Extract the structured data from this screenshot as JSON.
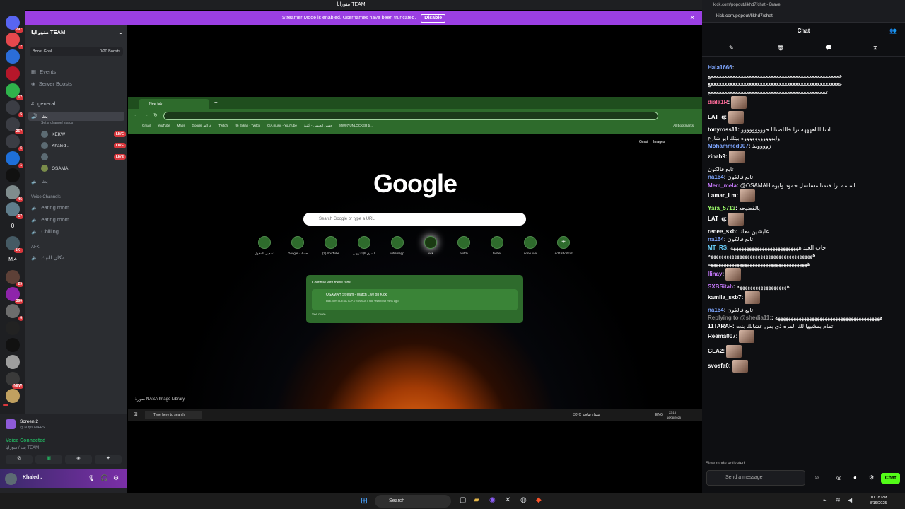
{
  "discord": {
    "window_title": "منورايا TEAM",
    "banner_text": "Streamer Mode is enabled. Usernames have been truncated.",
    "banner_button": "Disable",
    "server_name": "منورايا TEAM",
    "boost_goal": "Boost Goal",
    "boost_count": "0/20 Boosts",
    "menu": [
      "Events",
      "Server Boosts"
    ],
    "text_channel": "general",
    "voice_channel": "بث",
    "channel_status": "Set a channel status",
    "voice_users": [
      {
        "name": "KEKW",
        "live": "LIVE"
      },
      {
        "name": "Khaled .",
        "live": "LIVE"
      },
      {
        "name": "...",
        "live": "LIVE"
      },
      {
        "name": "OSAMA",
        "live": ""
      }
    ],
    "voice_channel_2": "بث",
    "voice_section": "Voice Channels",
    "voice_rooms": [
      "eating room",
      "eating room",
      "Chilling"
    ],
    "afk_section": "AFK",
    "afk_room": "مكان النبك",
    "screen_title": "Screen 2",
    "screen_sub": "@ 60fps 60FPS",
    "voice_connected": "Voice Connected",
    "voice_location": "بث / منورايا TEAM",
    "user_name": "Khaled .",
    "guild_badges": [
      "297",
      "2",
      "17",
      "5",
      "267",
      "5",
      "1",
      "46",
      "17",
      "1K+",
      "29",
      "360",
      "6",
      "NEW"
    ],
    "guild_labels": [
      "0",
      "M.4"
    ]
  },
  "stream": {
    "tab_title": "New tab",
    "bookmarks": [
      "Gmail",
      "YouTube",
      "Maps",
      "Google خرائط",
      "Twitch",
      "(9) Bykan - Twitch",
      "CIA music - YouTube",
      "حسين الحبشي - أغنية",
      "MW07 UNLOCKER b..."
    ],
    "all_bookmarks": "All Bookmarks",
    "top_links": [
      "Gmail",
      "Images"
    ],
    "google": "Google",
    "search_placeholder": "Search Google or type a URL",
    "shortcuts": [
      "تسجيل الدخول",
      "Google حساب",
      "(2) YouTube",
      "السوق الإلكتروني",
      "whatsapp",
      "kick",
      "twitch",
      "twitter",
      "nono live",
      "Add shortcut"
    ],
    "continue_title": "Continue with these tabs",
    "continue_item": "OSAMAH Stream - Watch Live on Kick",
    "continue_sub": "kick.com • DESKTOP-7R8VX0A • You visited 49 mins ago",
    "see_more": "See more",
    "nasa": "صورة NASA Image Library",
    "taskbar_search": "Type here to search",
    "weather": "30°C سماء صافية",
    "lang": "ENG",
    "clock_time": "22:18",
    "clock_date": "16/08/2025"
  },
  "kick": {
    "window_title": "kick.com/popout/likhd7/chat - Brave",
    "url": "kick.com/popout/likhd7/chat",
    "chat_title": "Chat",
    "messages": [
      {
        "u": "Hala1666",
        "c": "#7ea6ff",
        "t": ""
      },
      {
        "u": "",
        "c": "#fff",
        "t": "ععععععععععععععععععععععععععععععععععععععععععععععععع"
      },
      {
        "u": "",
        "c": "#fff",
        "t": "ععععععععععععععععععععععععععععععععععععععععععععععععع"
      },
      {
        "u": "",
        "c": "#fff",
        "t": "عععععععععععععععععععععععععععععععععععععععععععع"
      },
      {
        "u": "diala1R",
        "c": "#ff6b9a",
        "t": ""
      },
      {
        "u": "LAT_q",
        "c": "#ffffff",
        "t": ""
      },
      {
        "u": "tonyross11",
        "c": "#ffffff",
        "t": "اسااااااههههه ترا خلللصنااا حووووووووو"
      },
      {
        "u": "",
        "c": "#fff",
        "t": "وابوووووووووووه بيتك ابو شارع"
      },
      {
        "u": "Mohammed007",
        "c": "#7ea6ff",
        "t": "زووووط"
      },
      {
        "u": "zinab9",
        "c": "#ffffff",
        "t": ""
      },
      {
        "u": "",
        "c": "#fff",
        "t": "تابع فالكون"
      },
      {
        "u": "na164",
        "c": "#7ea6ff",
        "t": "تابع فالكون"
      },
      {
        "u": "Mem_mela",
        "c": "#c97bff",
        "t": "@OSAMAH اسامه ترا ختمنا مسلسل حمود وابوه"
      },
      {
        "u": "Lamar_Lm",
        "c": "#ffffff",
        "t": ""
      },
      {
        "u": "Yara_5713",
        "c": "#9dff6b",
        "t": "يالفضيحه"
      },
      {
        "u": "LAT_q",
        "c": "#ffffff",
        "t": ""
      },
      {
        "u": "renee_sxb",
        "c": "#ffffff",
        "t": "عايشين معانا"
      },
      {
        "u": "na164",
        "c": "#7ea6ff",
        "t": "تابع فالكون"
      },
      {
        "u": "MT_RS",
        "c": "#6bd3ff",
        "t": "جاب العيد ههههههههههههههههههههههههههه"
      },
      {
        "u": "",
        "c": "#fff",
        "t": "ههههههههههههههههههههههههههههههههههههههههه"
      },
      {
        "u": "",
        "c": "#fff",
        "t": "ههههههههههههههههههههههههههههههههههههههه"
      },
      {
        "u": "llinay",
        "c": "#c97bff",
        "t": ""
      },
      {
        "u": "SXBSitah",
        "c": "#c97bff",
        "t": "هههههههههههههههههههه"
      },
      {
        "u": "kamila_sxb7",
        "c": "#ffffff",
        "t": ""
      },
      {
        "u": "na164",
        "c": "#7ea6ff",
        "t": "تابع فالكون"
      },
      {
        "u": "Replying to @shedia11:",
        "c": "#888",
        "t": "ههههههههههههههههههههههههههههههههههههههههه"
      },
      {
        "u": "11TARAF",
        "c": "#ffffff",
        "t": "تمام بمشيها لك المره ذي بس عشانك بنت"
      },
      {
        "u": "Reema007",
        "c": "#ffffff",
        "t": ""
      },
      {
        "u": "GLA2",
        "c": "#ffffff",
        "t": ""
      },
      {
        "u": "svosfa0",
        "c": "#ffffff",
        "t": ""
      }
    ],
    "slow_mode": "Slow mode activated",
    "input_placeholder": "Send a message",
    "send_label": "Chat"
  },
  "os": {
    "search": "Search",
    "time": "10:18 PM",
    "date": "8/16/2025"
  },
  "colors": {
    "kick_green": "#53fc18",
    "discord_purple": "#9b3fe3",
    "chrome_green": "#2e6b2c",
    "live_red": "#da373c"
  }
}
